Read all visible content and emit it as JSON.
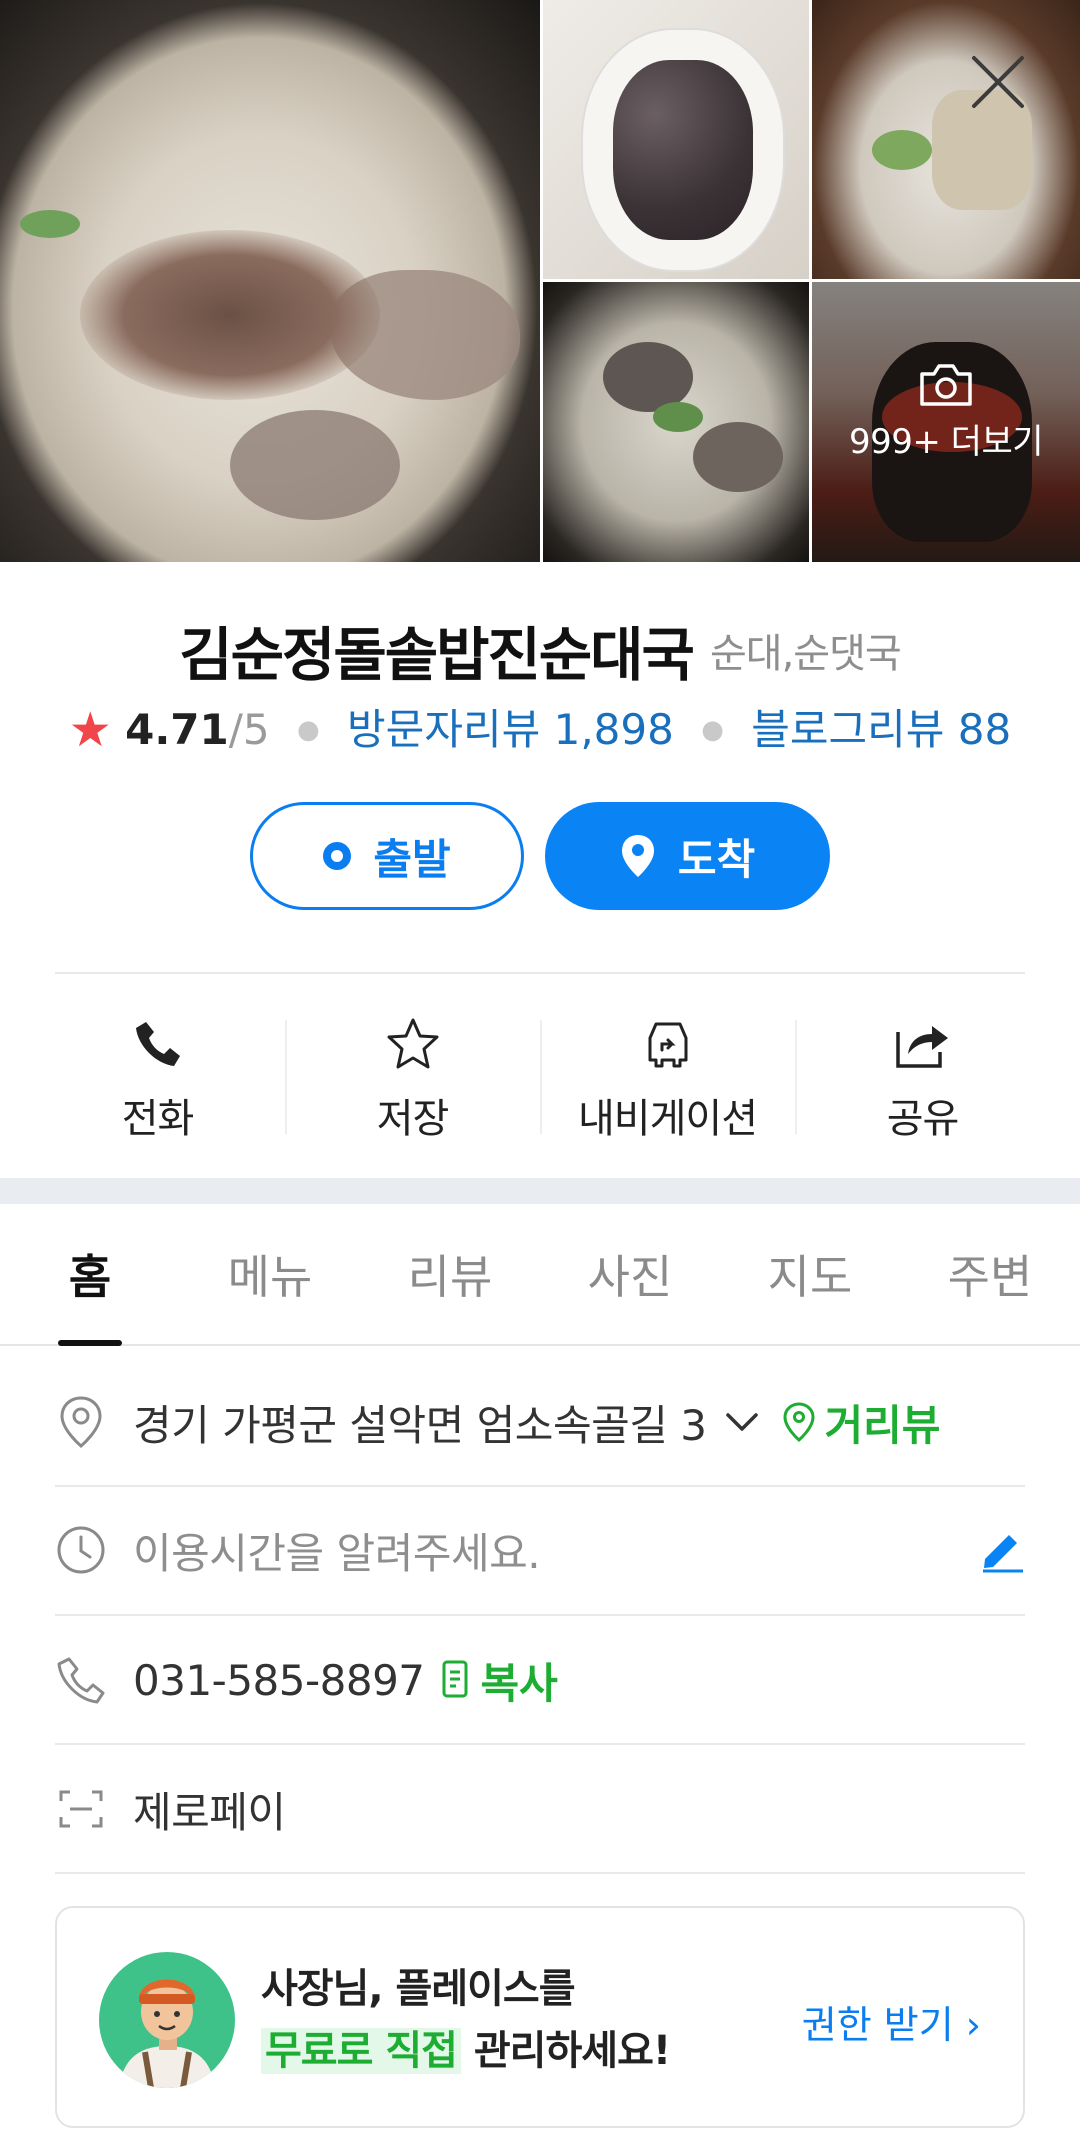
{
  "photos": {
    "more_label": "999+ 더보기",
    "items": [
      "main-soup-photo",
      "sundae-plate-photo",
      "bone-soup-photo",
      "soup-bowl-photo",
      "kimchi-pot-photo"
    ]
  },
  "place": {
    "name": "김순정돌솥밥진순대국",
    "category": "순대,순댓국",
    "rating": "4.71",
    "rating_max": "/5",
    "visitor_reviews": "방문자리뷰 1,898",
    "blog_reviews": "블로그리뷰 88"
  },
  "route": {
    "start_label": "출발",
    "end_label": "도착"
  },
  "actions": {
    "call": "전화",
    "save": "저장",
    "navigation": "내비게이션",
    "share": "공유"
  },
  "tabs": [
    "홈",
    "메뉴",
    "리뷰",
    "사진",
    "지도",
    "주변"
  ],
  "info": {
    "address": "경기 가평군 설악면 엄소속골길 3",
    "street_view": "거리뷰",
    "hours_placeholder": "이용시간을 알려주세요.",
    "phone": "031-585-8897",
    "copy": "복사",
    "payment": "제로페이"
  },
  "promo": {
    "line1": "사장님, 플레이스를",
    "highlight": "무료로 직접",
    "line2_rest": " 관리하세요!",
    "cta": "권한 받기"
  },
  "colors": {
    "accent_blue": "#0a84f5",
    "link_blue": "#1a6fbd",
    "green": "#1cad32",
    "star_red": "#f0454a"
  }
}
